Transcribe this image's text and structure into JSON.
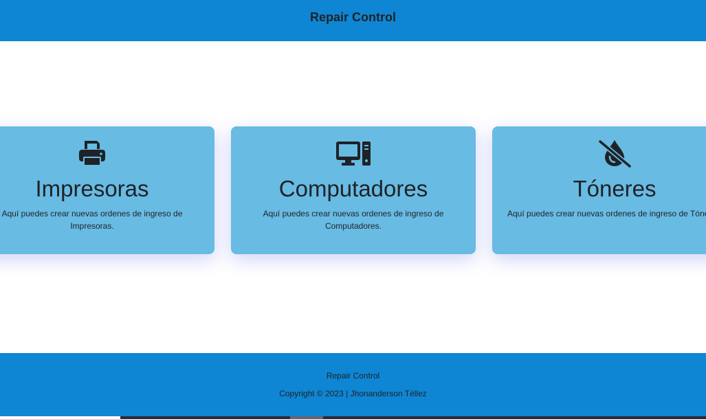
{
  "header": {
    "title": "Repair Control"
  },
  "cards": [
    {
      "icon": "printer-icon",
      "title": "Impresoras",
      "description": "Aquí puedes crear nuevas ordenes de ingreso de Impresoras."
    },
    {
      "icon": "computer-icon",
      "title": "Computadores",
      "description": "Aquí puedes crear nuevas ordenes de ingreso de Computadores."
    },
    {
      "icon": "droplet-slash-icon",
      "title": "Tóneres",
      "description": "Aquí puedes crear nuevas ordenes de ingreso de Tóneres."
    }
  ],
  "footer": {
    "name": "Repair Control",
    "copyright": "Copyright © 2023 | Jhonanderson Téllez"
  },
  "colors": {
    "primary": "#0e86d4",
    "card": "#68bbe3",
    "text": "#1f2226"
  }
}
